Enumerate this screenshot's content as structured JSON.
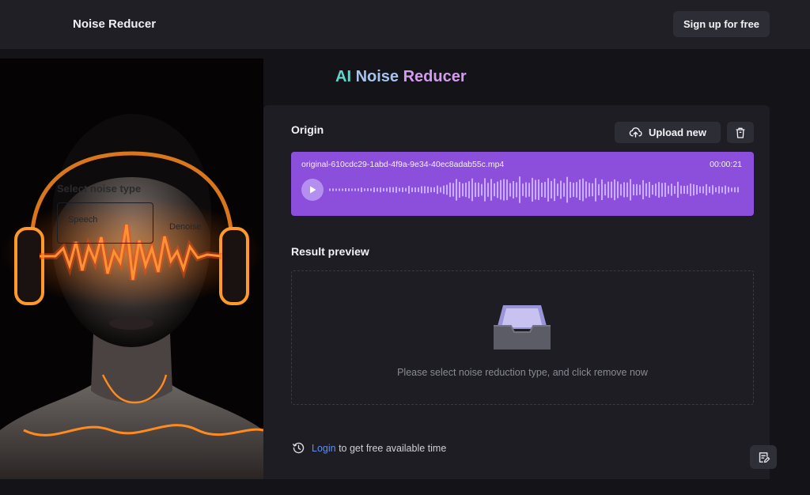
{
  "header": {
    "brand": "Noise Reducer",
    "signup_label": "Sign up for free"
  },
  "hero": {
    "ghost_select_label": "Select noise type",
    "ghost_option_1": "Speech",
    "ghost_option_2": "Denoise"
  },
  "title": {
    "part1": "AI",
    "part2": "Noise",
    "part3": "Reducer"
  },
  "origin": {
    "label": "Origin",
    "upload_label": "Upload new",
    "file_name": "original-610cdc29-1abd-4f9a-9e34-40ec8adab55c.mp4",
    "duration": "00:00:21"
  },
  "result": {
    "label": "Result preview",
    "hint": "Please select noise reduction type, and click remove now"
  },
  "footer": {
    "login_link": "Login",
    "login_suffix": "to get free available time"
  },
  "colors": {
    "accent_purple": "#8b4fdb",
    "link_blue": "#5c8ff0",
    "title_teal": "#5fd7c8",
    "title_pink": "#d49cf1"
  }
}
